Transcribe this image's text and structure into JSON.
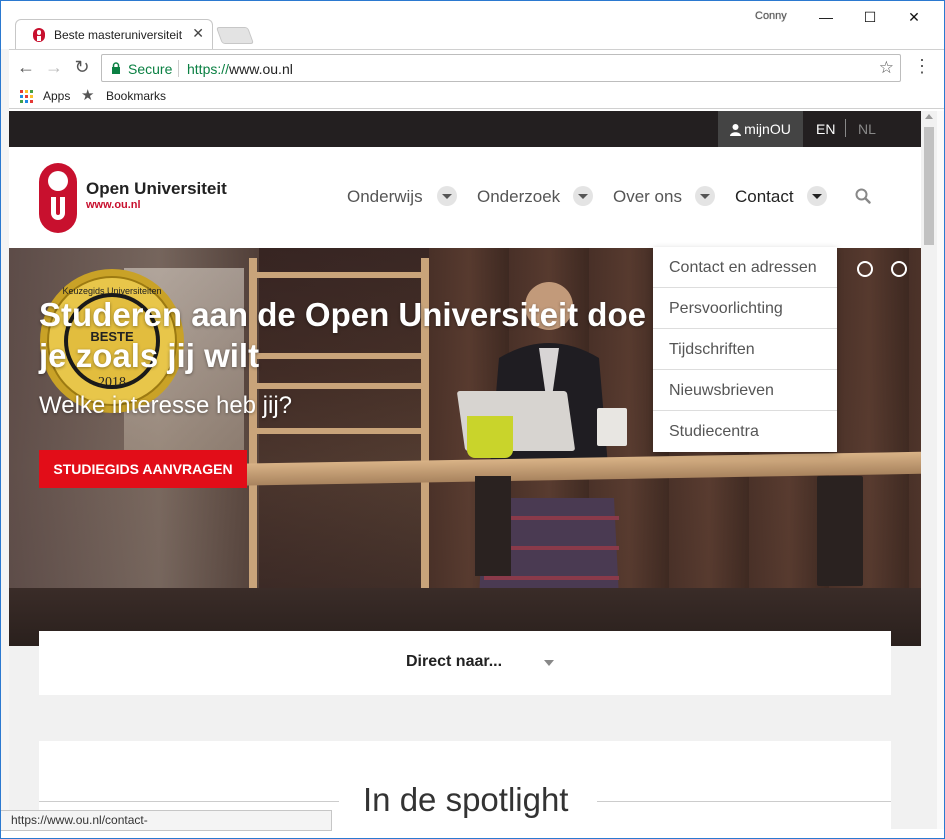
{
  "browser": {
    "tab_title": "Beste masteruniversiteit",
    "profile_name": "Conny",
    "secure_label": "Secure",
    "url_scheme": "https://",
    "url_host": "www.ou.nl",
    "bookmarks": [
      {
        "label": "Apps"
      },
      {
        "label": "Bookmarks"
      }
    ],
    "status_url": "https://www.ou.nl/contact-"
  },
  "topbar": {
    "account_label": "mijnOU",
    "lang_active": "EN",
    "lang_inactive": "NL"
  },
  "logo": {
    "name": "Open Universiteit",
    "url": "www.ou.nl",
    "brand_color": "#c8102e"
  },
  "nav": {
    "items": [
      {
        "label": "Onderwijs"
      },
      {
        "label": "Onderzoek"
      },
      {
        "label": "Over ons"
      },
      {
        "label": "Contact"
      }
    ],
    "active": "Contact"
  },
  "contact_menu": {
    "items": [
      "Contact en adressen",
      "Persvoorlichting",
      "Tijdschriften",
      "Nieuwsbrieven",
      "Studiecentra"
    ]
  },
  "hero": {
    "title": "Studeren aan de Open Universiteit doe je zoals jij wilt",
    "subtitle": "Welke interesse heb jij?",
    "cta": "STUDIEGIDS AANVRAGEN",
    "badge": {
      "line1": "Keuzegids Universiteiten",
      "line2": "BESTE",
      "line3": "2018"
    },
    "cta_color": "#e20d18"
  },
  "direct": {
    "label": "Direct naar..."
  },
  "spotlight": {
    "title": "In de spotlight"
  }
}
